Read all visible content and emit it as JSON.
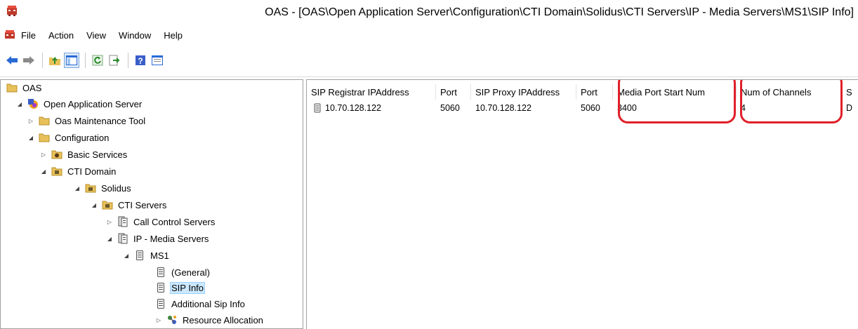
{
  "window": {
    "title": "OAS - [OAS\\Open Application Server\\Configuration\\CTI Domain\\Solidus\\CTI Servers\\IP - Media Servers\\MS1\\SIP Info]"
  },
  "menu": [
    "File",
    "Action",
    "View",
    "Window",
    "Help"
  ],
  "toolbar": {
    "buttons": [
      "back-icon",
      "forward-icon",
      "up-folder-icon",
      "show-hide-tree-icon",
      "refresh-icon",
      "export-list-icon",
      "help-icon",
      "properties-pane-icon"
    ]
  },
  "tree": [
    {
      "label": "OAS",
      "icon": "folder-icon"
    },
    {
      "label": "Open Application Server",
      "icon": "server-app-icon"
    },
    {
      "label": "Oas Maintenance Tool",
      "icon": "folder-icon"
    },
    {
      "label": "Configuration",
      "icon": "folder-icon"
    },
    {
      "label": "Basic Services",
      "icon": "gear-folder-icon"
    },
    {
      "label": "CTI Domain",
      "icon": "domain-icon"
    },
    {
      "label": "Solidus",
      "icon": "domain-icon"
    },
    {
      "label": "CTI Servers",
      "icon": "domain-icon"
    },
    {
      "label": "Call Control Servers",
      "icon": "servers-icon"
    },
    {
      "label": "IP - Media Servers",
      "icon": "servers-icon"
    },
    {
      "label": "MS1",
      "icon": "server-icon"
    },
    {
      "label": "(General)",
      "icon": "server-icon"
    },
    {
      "label": "SIP Info",
      "icon": "server-icon",
      "selected": true
    },
    {
      "label": "Additional Sip Info",
      "icon": "server-icon"
    },
    {
      "label": "Resource Allocation",
      "icon": "resource-icon"
    }
  ],
  "table": {
    "columns": [
      "SIP Registrar IPAddress",
      "Port",
      "SIP Proxy IPAddress",
      "Port",
      "Media Port Start Num",
      "Num of Channels",
      "S"
    ],
    "rows": [
      [
        "10.70.128.122",
        "5060",
        "10.70.128.122",
        "5060",
        "3400",
        "4",
        "D"
      ]
    ]
  },
  "colors": {
    "highlight_ring": "#e0202a",
    "selection": "#cce8ff",
    "folder": "#e8c15a"
  }
}
